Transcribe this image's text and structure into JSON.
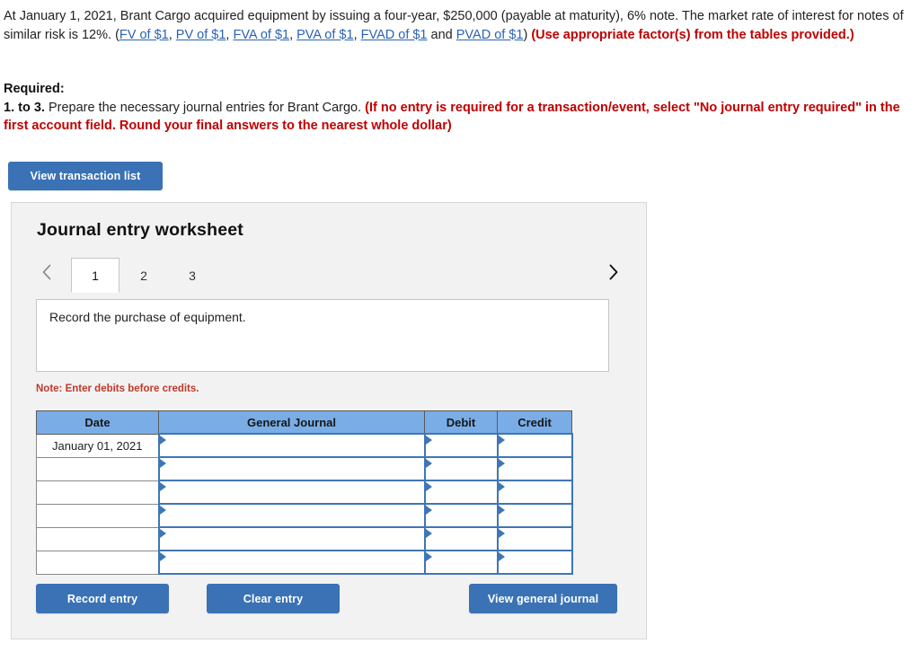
{
  "problem": {
    "text_part1": "At January 1, 2021, Brant Cargo acquired equipment by issuing a four-year, $250,000 (payable at maturity), 6% note. The market rate of interest for notes of similar risk is 12%. (",
    "links": [
      {
        "label": "FV of $1"
      },
      {
        "label": "PV of $1"
      },
      {
        "label": "FVA of $1"
      },
      {
        "label": "PVA of $1"
      },
      {
        "label": "FVAD of $1"
      },
      {
        "label": "PVAD of $1"
      }
    ],
    "link_separator": ", ",
    "link_conjunction": " and ",
    "text_part2": ") ",
    "emphasis": "(Use appropriate factor(s) from the tables provided.)"
  },
  "required": {
    "heading": "Required:",
    "number": "1. to 3.",
    "instruction": " Prepare the necessary journal entries for Brant Cargo. ",
    "emphasis": "(If no entry is required for a transaction/event, select \"No journal entry required\" in the first account field. Round your final answers to the nearest whole dollar)"
  },
  "toolbar": {
    "view_transaction_list_label": "View transaction list"
  },
  "worksheet": {
    "title": "Journal entry worksheet",
    "tabs": [
      {
        "label": "1",
        "active": true
      },
      {
        "label": "2",
        "active": false
      },
      {
        "label": "3",
        "active": false
      }
    ],
    "prev_icon": "chevron-left-icon",
    "next_icon": "chevron-right-icon",
    "description": "Record the purchase of equipment.",
    "note": "Note: Enter debits before credits.",
    "table": {
      "columns": [
        "Date",
        "General Journal",
        "Debit",
        "Credit"
      ],
      "rows": [
        {
          "date": "January 01, 2021",
          "general_journal": "",
          "debit": "",
          "credit": ""
        },
        {
          "date": "",
          "general_journal": "",
          "debit": "",
          "credit": ""
        },
        {
          "date": "",
          "general_journal": "",
          "debit": "",
          "credit": ""
        },
        {
          "date": "",
          "general_journal": "",
          "debit": "",
          "credit": ""
        },
        {
          "date": "",
          "general_journal": "",
          "debit": "",
          "credit": ""
        },
        {
          "date": "",
          "general_journal": "",
          "debit": "",
          "credit": ""
        }
      ]
    },
    "buttons": {
      "record_entry_label": "Record entry",
      "clear_entry_label": "Clear entry",
      "view_general_journal_label": "View general journal"
    }
  },
  "colors": {
    "button_blue": "#3a72b5",
    "header_blue": "#7aade5",
    "input_border_blue": "#3f76b5",
    "link_blue": "#2a62b6",
    "emphasis_red": "#c00000",
    "note_red": "#c0392b",
    "panel_bg": "#f2f2f2"
  }
}
